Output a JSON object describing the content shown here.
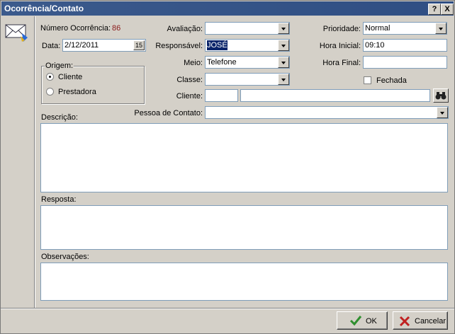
{
  "window": {
    "title": "Ocorrência/Contato",
    "help_label": "?",
    "close_label": "X"
  },
  "header": {
    "numero_label": "Número Ocorrência:",
    "numero_value": "86",
    "data_label": "Data:",
    "data_value": "2/12/2011",
    "calendar_label": "15"
  },
  "origem": {
    "legend": "Origem:",
    "options": [
      "Cliente",
      "Prestadora"
    ],
    "selected": "Cliente"
  },
  "form": {
    "avaliacao_label": "Avaliação:",
    "avaliacao_value": "",
    "responsavel_label": "Responsável:",
    "responsavel_value": "JOSÉ",
    "meio_label": "Meio:",
    "meio_value": "Telefone",
    "classe_label": "Classe:",
    "classe_value": "",
    "cliente_label": "Cliente:",
    "cliente_code": "",
    "cliente_name": "",
    "pessoa_label": "Pessoa de Contato:",
    "pessoa_value": "",
    "prioridade_label": "Prioridade:",
    "prioridade_value": "Normal",
    "hora_inicial_label": "Hora Inicial:",
    "hora_inicial_value": "09:10",
    "hora_final_label": "Hora Final:",
    "hora_final_value": "",
    "fechada_label": "Fechada"
  },
  "sections": {
    "descricao_label": "Descrição:",
    "resposta_label": "Resposta:",
    "observacoes_label": "Observações:"
  },
  "buttons": {
    "ok_label": "OK",
    "cancel_label": "Cancelar"
  },
  "colors": {
    "title_bar": "#2f4e83",
    "number": "#8b1a1a",
    "ok_check": "#2f8f2f",
    "cancel_x": "#c02020",
    "selection": "#0a246a"
  }
}
